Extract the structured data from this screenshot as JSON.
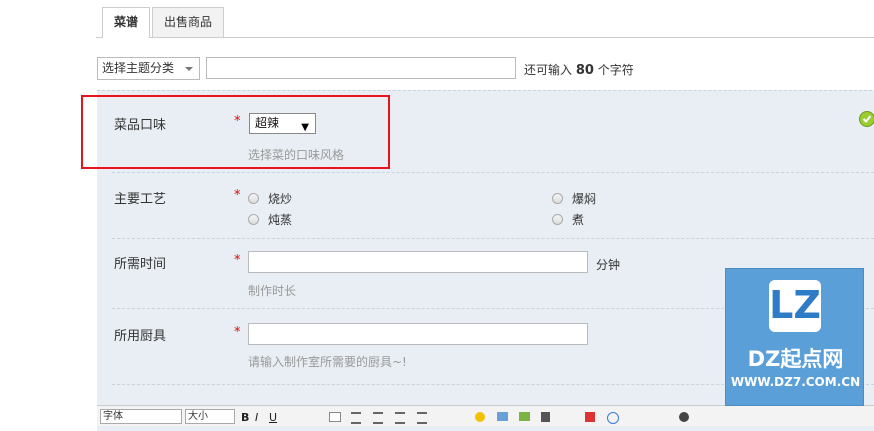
{
  "tabs": [
    {
      "label": "菜谱",
      "active": true
    },
    {
      "label": "出售商品",
      "active": false
    }
  ],
  "subject": {
    "category_value": "选择主题分类",
    "title_value": "",
    "char_hint_prefix": "还可输入",
    "char_hint_count": "80",
    "char_hint_suffix": "个字符"
  },
  "form": {
    "flavor": {
      "label": "菜品口味",
      "required": "*",
      "selected": "超辣",
      "hint": "选择菜的口味风格"
    },
    "technique": {
      "label": "主要工艺",
      "required": "*",
      "options": [
        "烧炒",
        "爆焖",
        "炖蒸",
        "煮"
      ]
    },
    "time": {
      "label": "所需时间",
      "required": "*",
      "value": "",
      "unit": "分钟",
      "hint": "制作时长"
    },
    "tools": {
      "label": "所用厨具",
      "required": "*",
      "value": "",
      "hint": "请输入制作室所需要的厨具~!"
    }
  },
  "toolbar": {
    "font": "字体",
    "size": "大小",
    "bold": "B",
    "italic": "I",
    "underline": "U"
  },
  "watermark": {
    "mark": "LZ",
    "name": "DZ起点网",
    "url": "WWW.DZ7.COM.CN"
  },
  "colors": {
    "highlight": "#e8141b",
    "panel": "#e8eef4",
    "logo": "#5a9fd8",
    "ok": "#9acd32"
  }
}
